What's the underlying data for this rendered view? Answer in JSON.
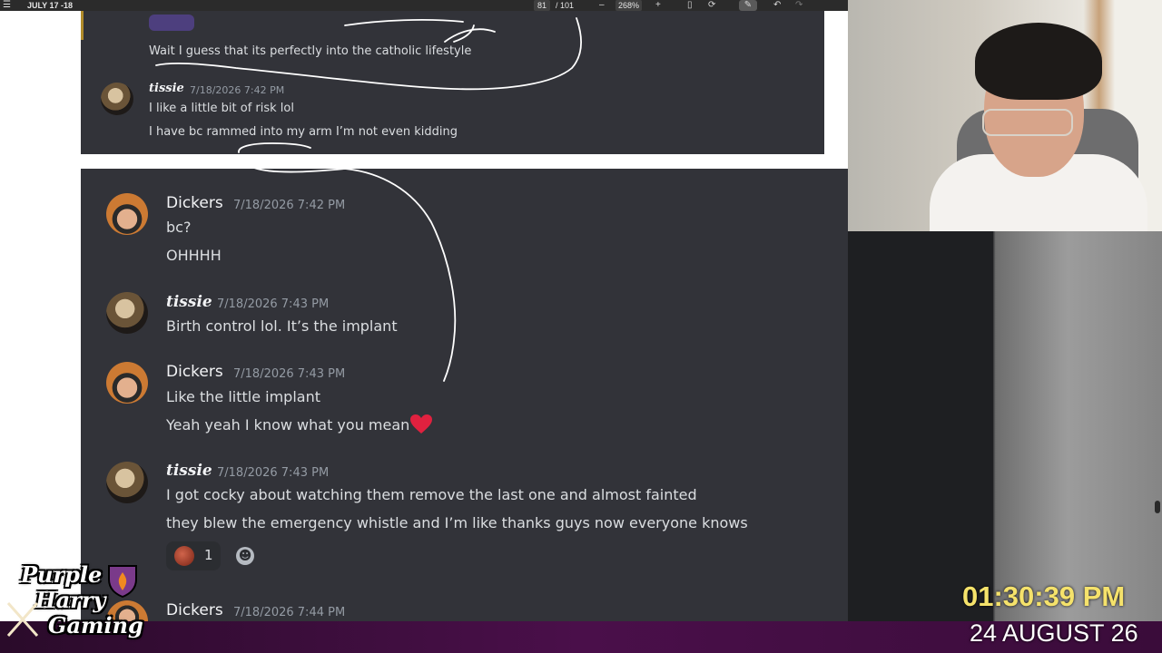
{
  "toolbar": {
    "title": "JULY 17 -18",
    "page_current": "81",
    "page_total": "/ 101",
    "zoom": "268%",
    "zoom_out": "–",
    "zoom_in": "+",
    "undo": "↶",
    "redo": "↷"
  },
  "panel1": {
    "messages": [
      {
        "text": "Wait I guess that its perfectly into the catholic lifestyle"
      },
      {
        "author": "tissie",
        "timestamp": "7/18/2026 7:42 PM",
        "lines": [
          "I like a little bit of risk lol",
          "I have bc rammed into my arm I’m not even kidding"
        ]
      }
    ]
  },
  "panel2": {
    "messages": [
      {
        "author": "Dickers",
        "timestamp": "7/18/2026 7:42 PM",
        "lines": [
          "bc?",
          "OHHHH"
        ]
      },
      {
        "author": "tissie",
        "timestamp": "7/18/2026 7:43 PM",
        "lines": [
          "Birth control lol. It’s the implant"
        ]
      },
      {
        "author": "Dickers",
        "timestamp": "7/18/2026 7:43 PM",
        "lines": [
          "Like the little implant",
          "Yeah yeah I know what you mean"
        ]
      },
      {
        "author": "tissie",
        "timestamp": "7/18/2026 7:43 PM",
        "lines": [
          "I got cocky about watching them remove the last one and almost fainted",
          "they blew the emergency whistle and I’m like thanks guys now everyone knows"
        ],
        "reaction_count": "1"
      },
      {
        "author": "Dickers",
        "timestamp": "7/18/2026 7:44 PM"
      }
    ]
  },
  "overlay": {
    "logo": [
      "Purple",
      "Harry",
      "Gaming"
    ],
    "clock_time": "01:30:39 PM",
    "clock_date": "24 AUGUST 26"
  },
  "colors": {
    "discord_bg": "#323339",
    "clock_yellow": "#f5e26b",
    "heart_red": "#e0213f",
    "bottom_bar": "#4a0f4a"
  }
}
